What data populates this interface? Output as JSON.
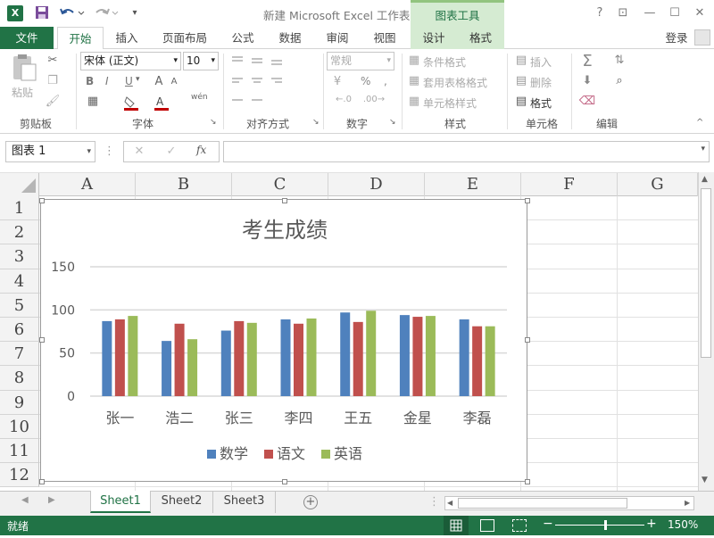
{
  "titlebar": {
    "title": "新建 Microsoft Excel 工作表 - Excel",
    "chart_tools": "图表工具",
    "app_icon": "excel-icon"
  },
  "tabs": {
    "file": "文件",
    "home": "开始",
    "insert": "插入",
    "page_layout": "页面布局",
    "formulas": "公式",
    "data": "数据",
    "review": "审阅",
    "view": "视图",
    "design": "设计",
    "format": "格式",
    "signin": "登录"
  },
  "ribbon": {
    "clipboard": {
      "paste": "粘贴",
      "label": "剪贴板"
    },
    "font": {
      "name": "宋体 (正文)",
      "size": "10",
      "bold": "B",
      "italic": "I",
      "underline": "U",
      "label": "字体",
      "phonetic": "wén"
    },
    "alignment": {
      "label": "对齐方式"
    },
    "number": {
      "format": "常规",
      "percent": "%",
      "comma": ",",
      "label": "数字"
    },
    "styles": {
      "conditional": "条件格式",
      "table": "套用表格格式",
      "cell": "单元格样式",
      "label": "样式"
    },
    "cells": {
      "insert": "插入",
      "delete": "删除",
      "format": "格式",
      "label": "单元格"
    },
    "editing": {
      "label": "编辑"
    }
  },
  "formula_bar": {
    "name_box": "图表 1",
    "fx": "fx",
    "formula": ""
  },
  "columns": [
    "A",
    "B",
    "C",
    "D",
    "E",
    "F",
    "G"
  ],
  "rows": [
    "1",
    "2",
    "3",
    "4",
    "5",
    "6",
    "7",
    "8",
    "9",
    "10",
    "11",
    "12"
  ],
  "sheets": [
    "Sheet1",
    "Sheet2",
    "Sheet3"
  ],
  "status": {
    "ready": "就绪",
    "zoom": "150%"
  },
  "colors": {
    "accent": "#217346",
    "series1": "#4f81bd",
    "series2": "#c0504d",
    "series3": "#9bbb59"
  },
  "chart_data": {
    "type": "bar",
    "title": "考生成绩",
    "categories": [
      "张一",
      "浩二",
      "张三",
      "李四",
      "王五",
      "金星",
      "李磊"
    ],
    "series": [
      {
        "name": "数学",
        "values": [
          87,
          64,
          76,
          89,
          97,
          94,
          89
        ]
      },
      {
        "name": "语文",
        "values": [
          89,
          84,
          87,
          84,
          86,
          92,
          81
        ]
      },
      {
        "name": "英语",
        "values": [
          93,
          66,
          85,
          90,
          99,
          93,
          81
        ]
      }
    ],
    "ylim": [
      0,
      150
    ],
    "yticks": [
      "0",
      "50",
      "100",
      "150"
    ],
    "grid": true,
    "legend": "bottom"
  }
}
